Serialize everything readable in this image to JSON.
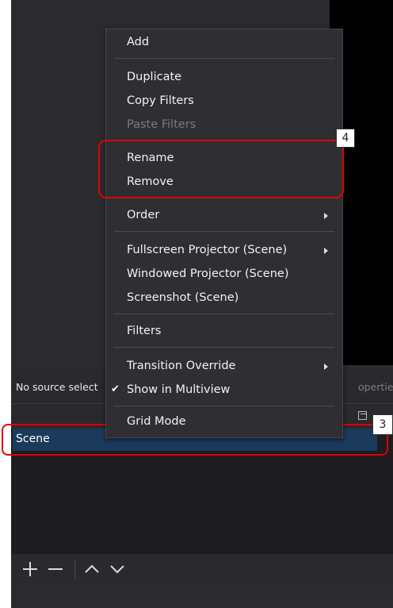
{
  "source_bar": {
    "no_source_text": "No source select",
    "properties_text": "operties"
  },
  "scenes": {
    "items": [
      {
        "label": "Scene",
        "selected": true
      }
    ]
  },
  "context_menu": {
    "items": {
      "add": "Add",
      "duplicate": "Duplicate",
      "copy_filters": "Copy Filters",
      "paste_filters": "Paste Filters",
      "rename": "Rename",
      "remove": "Remove",
      "order": "Order",
      "fullscreen_projector": "Fullscreen Projector (Scene)",
      "windowed_projector": "Windowed Projector (Scene)",
      "screenshot": "Screenshot (Scene)",
      "filters": "Filters",
      "transition_override": "Transition Override",
      "show_in_multiview": "Show in Multiview",
      "grid_mode": "Grid Mode"
    },
    "show_in_multiview_checked": true,
    "paste_filters_disabled": true
  },
  "annotations": {
    "badge_scene": "3",
    "badge_rename": "4",
    "highlight_color": "#e00000"
  },
  "toolbar": {
    "icons": [
      "add-icon",
      "remove-icon",
      "move-up-icon",
      "move-down-icon"
    ]
  },
  "colors": {
    "background": "#2b2b2f",
    "menu_bg": "#2f2f33",
    "selection": "#1b3a5c"
  }
}
